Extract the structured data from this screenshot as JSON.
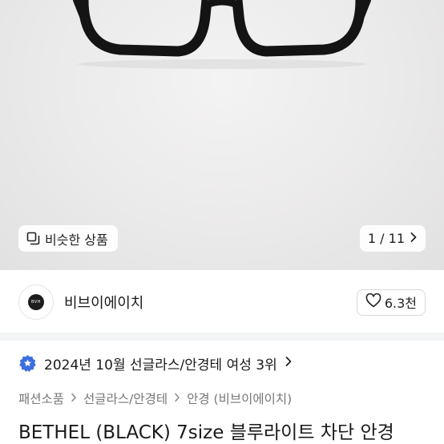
{
  "similar": {
    "label": "비슷한 상품",
    "icon": "duplicate-icon"
  },
  "gallery": {
    "counter": "1 / 11",
    "icon": "chevron-right-icon"
  },
  "shop": {
    "name": "비브이에이치",
    "logo_text": "BVH",
    "likes": "6.3천",
    "like_icon": "heart-icon"
  },
  "ranking": {
    "text": "2024년 10월 선글라스/안경테 여성 3위",
    "badge_icon": "star-badge-icon",
    "badge_color": "#3b6fe0"
  },
  "breadcrumb": [
    "패션소품",
    "선글라스/안경테",
    "안경 (비브이에이치)"
  ],
  "product": {
    "title": "BETHEL (BLACK) 7size 블루라이트 차단 안경"
  }
}
